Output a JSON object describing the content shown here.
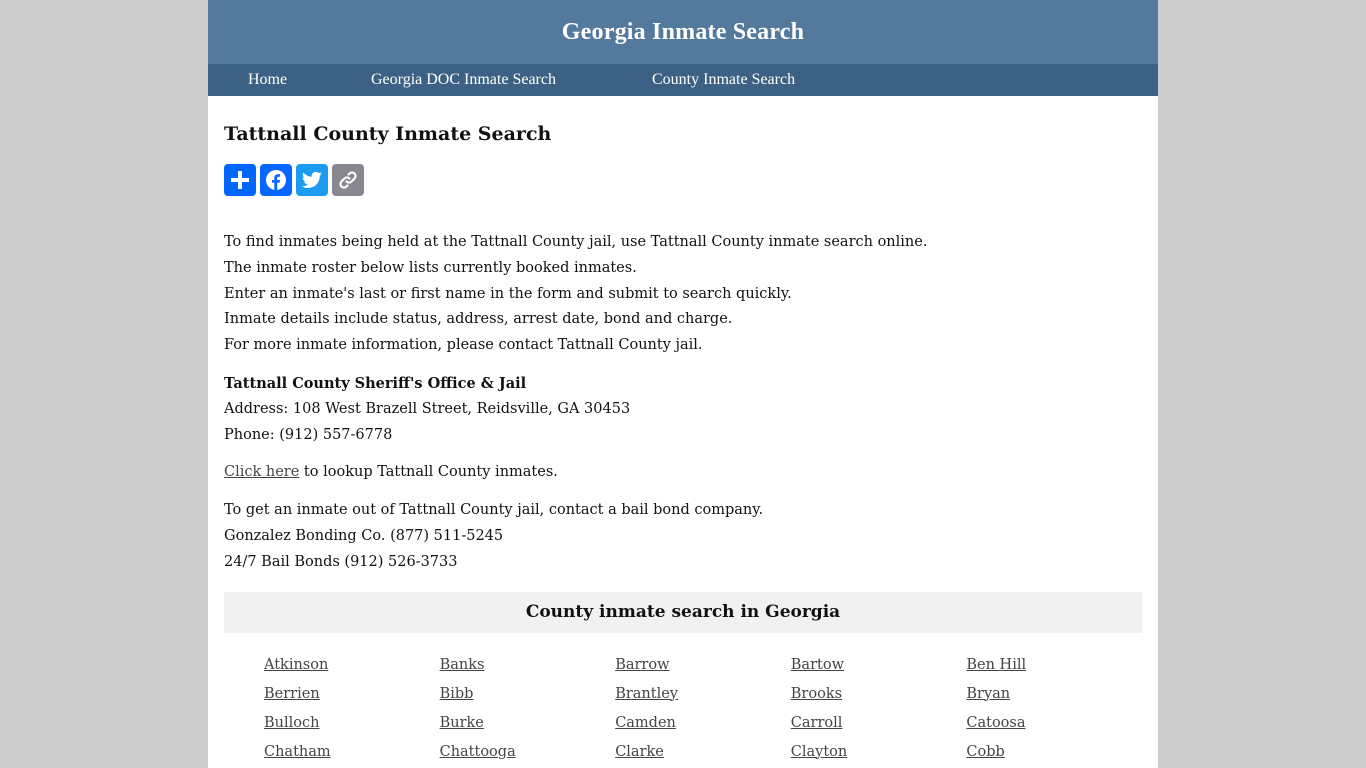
{
  "header": {
    "site_title": "Georgia Inmate Search"
  },
  "nav": {
    "items": [
      {
        "label": "Home"
      },
      {
        "label": "Georgia DOC Inmate Search"
      },
      {
        "label": "County Inmate Search"
      }
    ]
  },
  "main": {
    "page_title": "Tattnall County Inmate Search",
    "share_buttons": [
      {
        "icon": "plus-icon",
        "label": "Share",
        "color": "#0166ff"
      },
      {
        "icon": "facebook-icon",
        "label": "Facebook",
        "color": "#0866ff"
      },
      {
        "icon": "twitter-icon",
        "label": "Twitter",
        "color": "#1d9bf0"
      },
      {
        "icon": "link-icon",
        "label": "Copy Link",
        "color": "#888990"
      }
    ],
    "intro_lines": [
      "To find inmates being held at the Tattnall County jail, use Tattnall County inmate search online.",
      "The inmate roster below lists currently booked inmates.",
      "Enter an inmate's last or first name in the form and submit to search quickly.",
      "Inmate details include status, address, arrest date, bond and charge.",
      "For more inmate information, please contact Tattnall County jail."
    ],
    "office": {
      "name": "Tattnall County Sheriff's Office & Jail",
      "address": "Address: 108 West Brazell Street, Reidsville, GA 30453",
      "phone": "Phone: (912) 557-6778"
    },
    "lookup": {
      "link_label": "Click here",
      "suffix": " to lookup Tattnall County inmates."
    },
    "bail": {
      "intro": "To get an inmate out of Tattnall County jail, contact a bail bond company.",
      "companies": [
        "Gonzalez Bonding Co. (877) 511-5245",
        "24/7 Bail Bonds (912) 526-3733"
      ]
    },
    "county_section": {
      "title": "County inmate search in Georgia",
      "counties": [
        "Atkinson",
        "Banks",
        "Barrow",
        "Bartow",
        "Ben Hill",
        "Berrien",
        "Bibb",
        "Brantley",
        "Brooks",
        "Bryan",
        "Bulloch",
        "Burke",
        "Camden",
        "Carroll",
        "Catoosa",
        "Chatham",
        "Chattooga",
        "Clarke",
        "Clayton",
        "Cobb"
      ]
    }
  },
  "colors": {
    "header_bg": "#53799d",
    "nav_bg": "#3d6185",
    "page_bg": "#cccccc",
    "section_header_bg": "#f1f1f1",
    "link": "#444444"
  }
}
